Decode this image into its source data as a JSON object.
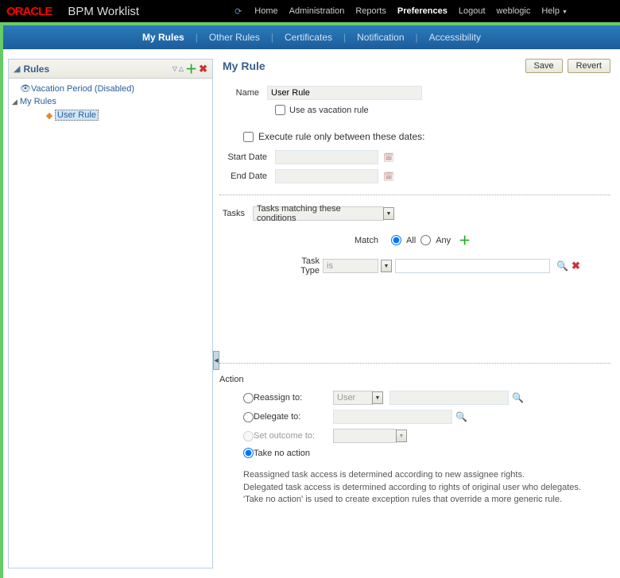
{
  "brand": "ORACLE",
  "app_title": "BPM Worklist",
  "topnav": {
    "home": "Home",
    "admin": "Administration",
    "reports": "Reports",
    "prefs": "Preferences",
    "logout": "Logout",
    "user": "weblogic",
    "help": "Help"
  },
  "subtabs": {
    "myrules": "My Rules",
    "other": "Other Rules",
    "certs": "Certificates",
    "notif": "Notification",
    "access": "Accessibility"
  },
  "left": {
    "title": "Rules",
    "vacation": "Vacation Period (Disabled)",
    "myrules": "My Rules",
    "userrule": "User Rule"
  },
  "right": {
    "title": "My Rule",
    "save": "Save",
    "revert": "Revert",
    "name_label": "Name",
    "name_value": "User Rule",
    "use_vacation": "Use as vacation rule",
    "execute_between": "Execute rule only between these dates:",
    "start_date": "Start Date",
    "end_date": "End Date",
    "tasks_label": "Tasks",
    "tasks_select": "Tasks matching these conditions",
    "match_label": "Match",
    "all": "All",
    "any": "Any",
    "tasktype_label": "Task Type",
    "op_is": "is",
    "action_label": "Action",
    "reassign": "Reassign to:",
    "reassign_select": "User",
    "delegate": "Delegate to:",
    "setoutcome": "Set outcome to:",
    "noaction": "Take no action",
    "help1": "Reassigned task access is determined according to new assignee rights.",
    "help2": "Delegated task access is determined according to rights of original user who delegates.",
    "help3": "'Take no action' is used to create exception rules that override a more generic rule."
  }
}
